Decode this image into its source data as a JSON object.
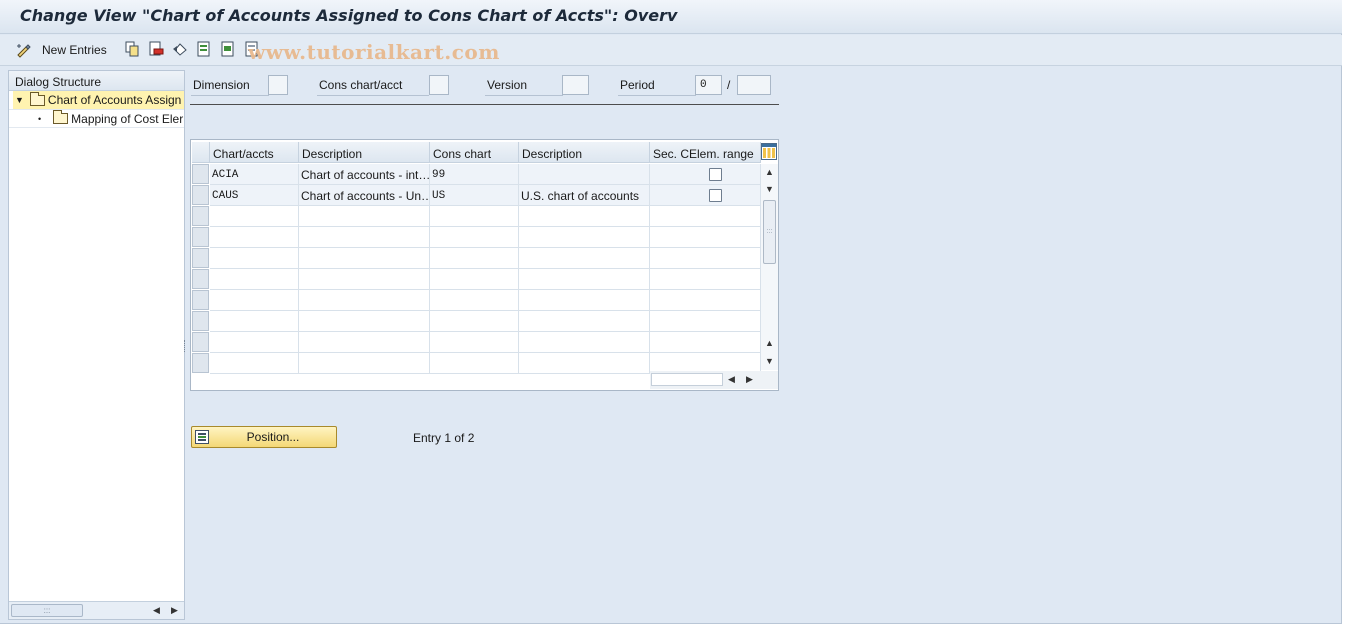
{
  "window": {
    "title": "Change View \"Chart of Accounts Assigned to Cons Chart of Accts\": Overv"
  },
  "toolbar": {
    "new_entries_label": "New Entries",
    "watermark": "www.tutorialkart.com",
    "icons": [
      "edit-toggle-icon",
      "copy-icon",
      "delete-icon",
      "undo-icon",
      "select-all-icon",
      "select-block-icon",
      "deselect-all-icon"
    ]
  },
  "dialog_structure": {
    "header": "Dialog Structure",
    "items": [
      {
        "label": "Chart of Accounts Assign",
        "level": 0,
        "expanded": true,
        "selected": true
      },
      {
        "label": "Mapping of Cost Eler",
        "level": 1,
        "expanded": false,
        "selected": false
      }
    ]
  },
  "fields": {
    "dimension": {
      "label": "Dimension",
      "value": ""
    },
    "cons_chart": {
      "label": "Cons chart/acct",
      "value": ""
    },
    "version": {
      "label": "Version",
      "value": ""
    },
    "period": {
      "label": "Period",
      "value": "0",
      "separator": "/",
      "year": ""
    }
  },
  "table": {
    "columns": [
      "Chart/accts",
      "Description",
      "Cons chart",
      "Description",
      "Sec. CElem. range"
    ],
    "rows": [
      {
        "chart": "ACIA",
        "description": "Chart of accounts - int…",
        "cons_chart": "99",
        "cons_description": "",
        "sec_range": false
      },
      {
        "chart": "CAUS",
        "description": "Chart of accounts - Un…",
        "cons_chart": "US",
        "cons_description": "U.S. chart of accounts",
        "sec_range": false
      }
    ],
    "empty_rows": 8
  },
  "footer": {
    "position_label": "Position...",
    "entry_text": "Entry 1 of 2"
  },
  "colors": {
    "background": "#dfe8f3",
    "selected_tree": "#fff3b0",
    "position_button": "#f4d876",
    "watermark": "#e8b98e"
  }
}
